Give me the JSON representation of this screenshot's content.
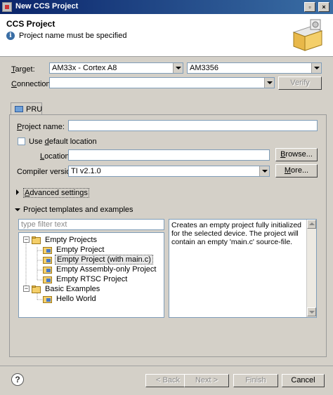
{
  "window": {
    "title": "New CCS Project"
  },
  "header": {
    "title": "CCS Project",
    "message": "Project name must be specified"
  },
  "target": {
    "label": "Target:",
    "family_value": "AM33x - Cortex A8",
    "device_value": "AM3356"
  },
  "connection": {
    "label": "Connection:",
    "value": "",
    "verify_label": "Verify"
  },
  "tab": {
    "label": "PRU"
  },
  "project": {
    "name_label": "Project name:",
    "name_value": "",
    "default_location_label": "Use default location",
    "location_label": "Location:",
    "location_value": "",
    "browse_label": "Browse...",
    "compiler_label": "Compiler version:",
    "compiler_value": "TI v2.1.0",
    "more_label": "More..."
  },
  "advanced": {
    "label": "Advanced settings"
  },
  "templates": {
    "label": "Project templates and examples",
    "filter_placeholder": "type filter text",
    "tree": [
      {
        "label": "Empty Projects"
      },
      {
        "label": "Empty Project"
      },
      {
        "label": "Empty Project (with main.c)"
      },
      {
        "label": "Empty Assembly-only Project"
      },
      {
        "label": "Empty RTSC Project"
      },
      {
        "label": "Basic Examples"
      },
      {
        "label": "Hello World"
      }
    ],
    "description": "Creates an empty project fully initialized for the selected device. The project will contain an empty 'main.c' source-file."
  },
  "footer": {
    "help_label": "?",
    "back_label": "< Back",
    "next_label": "Next >",
    "finish_label": "Finish",
    "cancel_label": "Cancel"
  }
}
